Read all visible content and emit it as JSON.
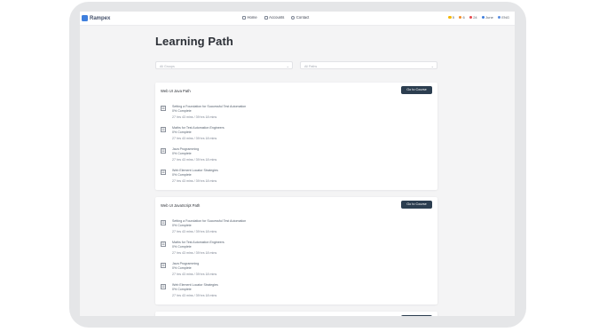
{
  "app": {
    "brand": "Rampex"
  },
  "nav": [
    {
      "label": "Home",
      "icon": "home-icon"
    },
    {
      "label": "Accounts",
      "icon": "accounts-icon"
    },
    {
      "label": "Contact",
      "icon": "contact-icon"
    }
  ],
  "stats": [
    {
      "value": "5",
      "color": "#f5b700"
    },
    {
      "value": "6",
      "color": "#f28c28"
    },
    {
      "value": "24",
      "color": "#e5484d"
    },
    {
      "value": "June",
      "color": "#3f7fdd"
    },
    {
      "value": "ENG",
      "color": "#5a8de0"
    }
  ],
  "page": {
    "title": "Learning Path"
  },
  "filters": {
    "left": "All Groups",
    "right": "All Paths"
  },
  "paths": [
    {
      "title": "Web UI Java Path",
      "button": "Go to Course",
      "courses": [
        {
          "name": "Setting a Foundation for Successful Test Automation",
          "progress": "0% Complete",
          "time": "27 hrs 43 mins / 39 hrs 18 mins"
        },
        {
          "name": "Maths for Test Automation Engineers",
          "progress": "0% Complete",
          "time": "27 hrs 43 mins / 39 hrs 18 mins"
        },
        {
          "name": "Java Programming",
          "progress": "0% Complete",
          "time": "27 hrs 43 mins / 39 hrs 18 mins"
        },
        {
          "name": "Web Element Locator Strategies",
          "progress": "0% Complete",
          "time": "27 hrs 43 mins / 39 hrs 18 mins"
        }
      ]
    },
    {
      "title": "Web UI JavaScript Path",
      "button": "Go to Course",
      "courses": [
        {
          "name": "Setting a Foundation for Successful Test Automation",
          "progress": "0% Complete",
          "time": "27 hrs 43 mins / 39 hrs 18 mins"
        },
        {
          "name": "Maths for Test Automation Engineers",
          "progress": "0% Complete",
          "time": "27 hrs 43 mins / 39 hrs 18 mins"
        },
        {
          "name": "Java Programming",
          "progress": "0% Complete",
          "time": "27 hrs 43 mins / 39 hrs 18 mins"
        },
        {
          "name": "Web Element Locator Strategies",
          "progress": "0% Complete",
          "time": "27 hrs 43 mins / 39 hrs 18 mins"
        }
      ]
    }
  ]
}
